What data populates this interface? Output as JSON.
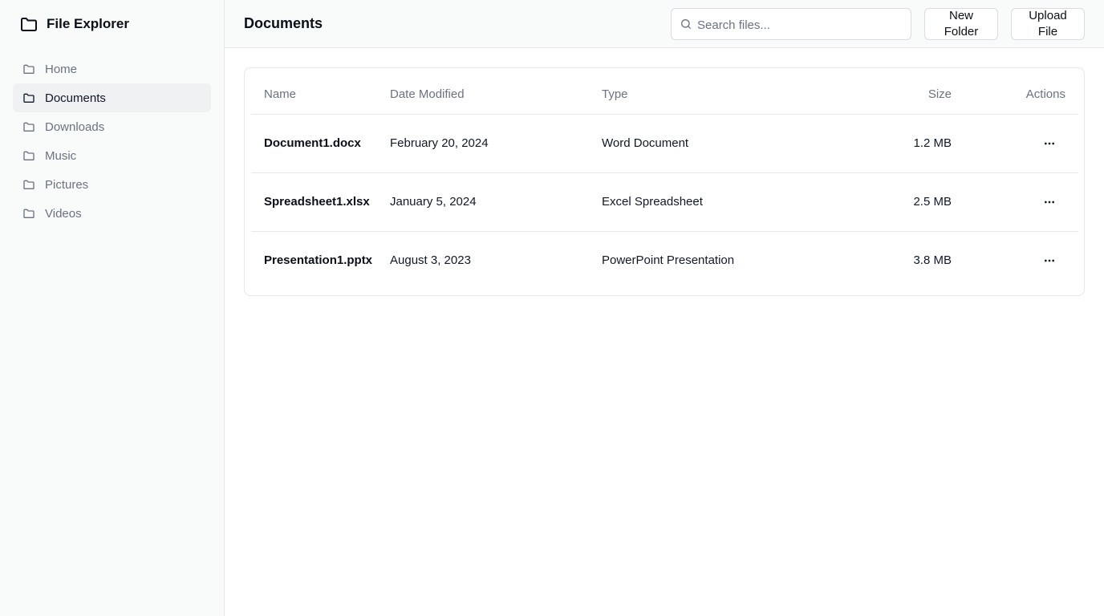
{
  "app": {
    "title": "File Explorer"
  },
  "sidebar": {
    "items": [
      {
        "label": "Home",
        "icon": "folder-icon"
      },
      {
        "label": "Documents",
        "icon": "folder-icon",
        "active": true
      },
      {
        "label": "Downloads",
        "icon": "folder-icon"
      },
      {
        "label": "Music",
        "icon": "folder-icon"
      },
      {
        "label": "Pictures",
        "icon": "folder-icon"
      },
      {
        "label": "Videos",
        "icon": "folder-icon"
      }
    ]
  },
  "header": {
    "title": "Documents",
    "search": {
      "placeholder": "Search files...",
      "value": ""
    },
    "new_folder_label": "New Folder",
    "upload_label": "Upload File"
  },
  "table": {
    "columns": {
      "name": "Name",
      "date": "Date Modified",
      "type": "Type",
      "size": "Size",
      "actions": "Actions"
    },
    "rows": [
      {
        "name": "Document1.docx",
        "date": "February 20, 2024",
        "type": "Word Document",
        "size": "1.2 MB",
        "action_icon": "more-horizontal-icon"
      },
      {
        "name": "Spreadsheet1.xlsx",
        "date": "January 5, 2024",
        "type": "Excel Spreadsheet",
        "size": "2.5 MB",
        "action_icon": "more-horizontal-icon"
      },
      {
        "name": "Presentation1.pptx",
        "date": "August 3, 2023",
        "type": "PowerPoint Presentation",
        "size": "3.8 MB",
        "action_icon": "more-horizontal-icon"
      }
    ]
  },
  "colors": {
    "sidebar_bg": "#f9fafa",
    "active_item_bg": "#f0f1f3",
    "muted_text": "#6b7280",
    "border": "#e5e7eb"
  }
}
